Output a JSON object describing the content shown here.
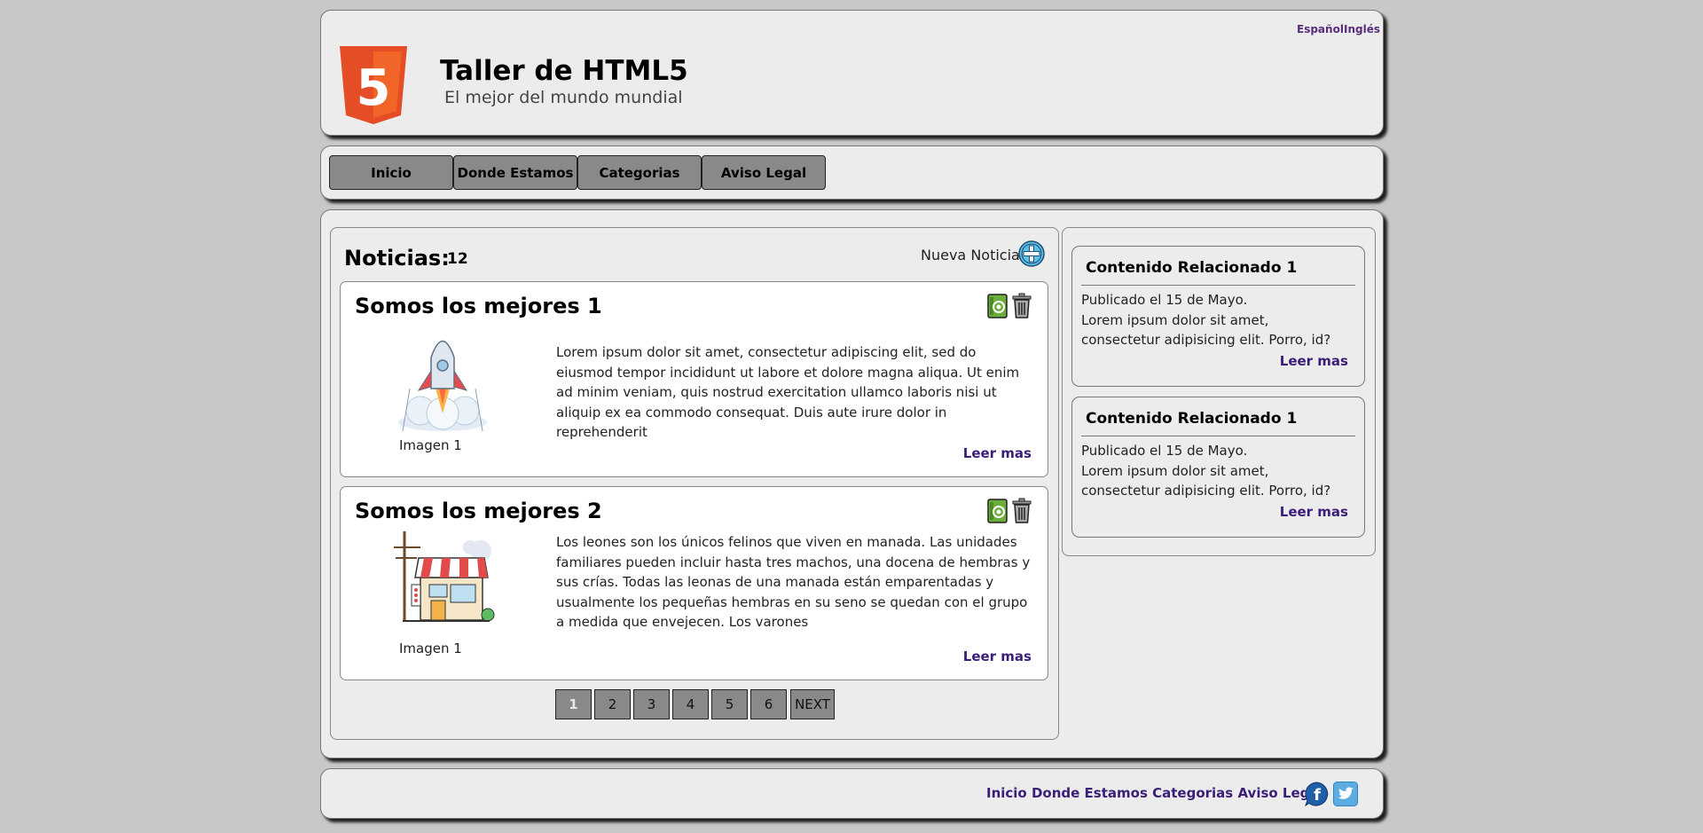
{
  "header": {
    "title": "Taller de HTML5",
    "subtitle": "El mejor del mundo mundial",
    "logo_text": "5",
    "languages": [
      "Español",
      "Inglés"
    ]
  },
  "nav": {
    "items": [
      "Inicio",
      "Donde Estamos",
      "Categorias",
      "Aviso Legal"
    ]
  },
  "news": {
    "heading": "Noticias:",
    "count": "12",
    "new_label": "Nueva Noticia:",
    "articles": [
      {
        "title": "Somos los mejores 1",
        "image": "rocket-illustration",
        "caption": "Imagen 1",
        "text": "Lorem ipsum dolor sit amet, consectetur adipiscing elit, sed do eiusmod tempor incididunt ut labore et dolore magna aliqua. Ut enim ad minim veniam, quis nostrud exercitation ullamco laboris nisi ut aliquip ex ea commodo consequat. Duis aute irure dolor in reprehenderit",
        "more": "Leer mas"
      },
      {
        "title": "Somos los mejores 2",
        "image": "shop-illustration",
        "caption": "Imagen 1",
        "text": "Los leones son los únicos felinos que viven en manada. Las unidades familiares pueden incluir hasta tres machos, una docena de hembras y sus crías. Todas las leonas de una manada están emparentadas y usualmente los pequeñas hembras en su seno se quedan con el grupo a medida que envejecen. Los varones",
        "more": "Leer mas"
      }
    ],
    "pagination": [
      "1",
      "2",
      "3",
      "4",
      "5",
      "6",
      "NEXT"
    ],
    "active_page": "1"
  },
  "related": [
    {
      "title": "Contenido Relacionado 1",
      "date": "Publicado el 15 de Mayo.",
      "text": "Lorem ipsum dolor sit amet, consectetur adipisicing elit. Porro, id?",
      "more": "Leer mas"
    },
    {
      "title": "Contenido Relacionado 1",
      "date": "Publicado el 15 de Mayo.",
      "text": "Lorem ipsum dolor sit amet, consectetur adipisicing elit. Porro, id?",
      "more": "Leer mas"
    }
  ],
  "footer": {
    "links": [
      "Inicio",
      "Donde Estamos",
      "Categorias",
      "Aviso Legal"
    ],
    "social": [
      "facebook-icon",
      "twitter-icon"
    ]
  },
  "colors": {
    "background": "#c9c8c9",
    "panel": "#ececec",
    "button": "#898989",
    "link": "#3b1e78",
    "html5_orange": "#e44d26",
    "add_icon": "#5bc0eb"
  }
}
